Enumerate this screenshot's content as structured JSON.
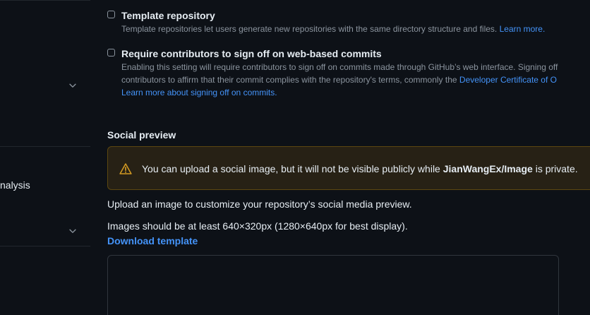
{
  "sidebar": {
    "partial_label": "nalysis"
  },
  "template_repo": {
    "title": "Template repository",
    "description": "Template repositories let users generate new repositories with the same directory structure and files.",
    "learn_more": "Learn more.",
    "checked": false
  },
  "signoff": {
    "title": "Require contributors to sign off on web-based commits",
    "description_line1": "Enabling this setting will require contributors to sign off on commits made through GitHub’s web interface. Signing off",
    "description_line2_text": "contributors to affirm that their commit complies with the repository's terms, commonly the",
    "description_line2_link": "Developer Certificate of O",
    "learn_more": "Learn more about signing off on commits.",
    "checked": false
  },
  "social_preview": {
    "title": "Social preview",
    "warning_text_before": "You can upload a social image, but it will not be visible publicly while",
    "warning_repo": "JianWangEx/Image",
    "warning_text_after": "is private.",
    "upload_desc": "Upload an image to customize your repository’s social media preview.",
    "size_desc": "Images should be at least 640×320px (1280×640px for best display).",
    "download_template": "Download template"
  },
  "colors": {
    "background": "#0d1117",
    "link": "#4493f8",
    "warning_bg": "#272115",
    "warning_border": "#5c4710",
    "warning_icon": "#d29922",
    "muted_text": "#8b949e"
  }
}
